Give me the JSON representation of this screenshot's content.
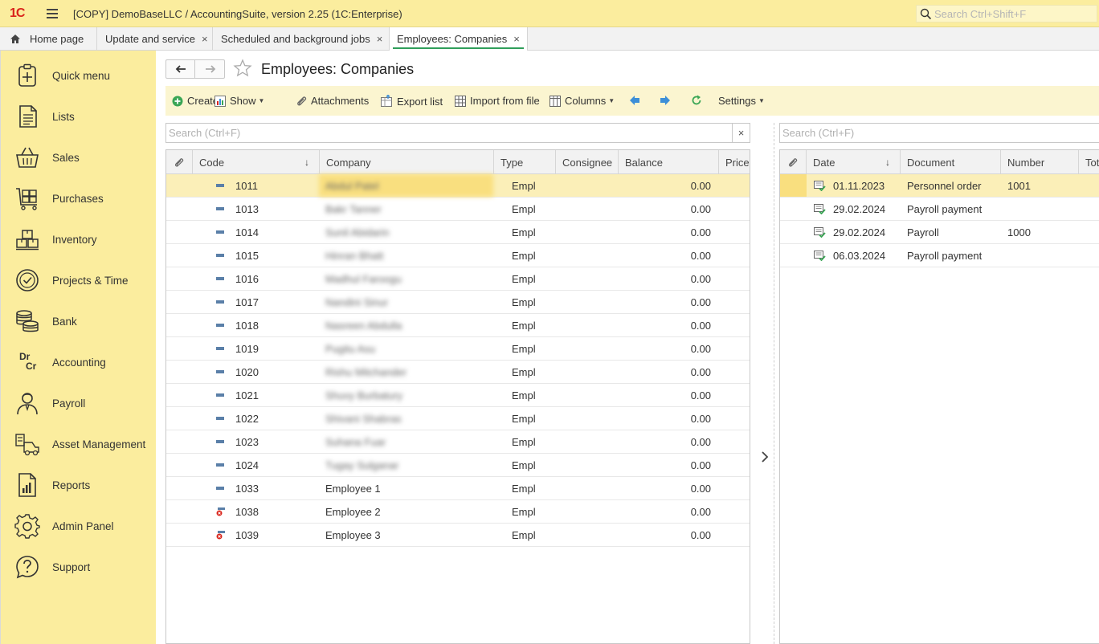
{
  "window": {
    "logo": "1C",
    "title": "[COPY] DemoBaseLLC / AccountingSuite, version 2.25  (1C:Enterprise)",
    "search_placeholder": "Search Ctrl+Shift+F"
  },
  "tabs": [
    {
      "label": "Home page",
      "icon": "home-icon"
    },
    {
      "label": "Update and service",
      "close": "×"
    },
    {
      "label": "Scheduled and background jobs",
      "close": "×"
    },
    {
      "label": "Employees: Companies",
      "close": "×",
      "active": true
    }
  ],
  "sidebar": {
    "items": [
      {
        "label": "Quick menu",
        "icon": "quick-menu-icon"
      },
      {
        "label": "Lists",
        "icon": "lists-icon"
      },
      {
        "label": "Sales",
        "icon": "basket-icon"
      },
      {
        "label": "Purchases",
        "icon": "cart-icon"
      },
      {
        "label": "Inventory",
        "icon": "boxes-icon"
      },
      {
        "label": "Projects & Time",
        "icon": "clock-icon"
      },
      {
        "label": "Bank",
        "icon": "coins-icon"
      },
      {
        "label": "Accounting",
        "icon": "dr-cr-icon",
        "glyph_top": "Dr",
        "glyph_bottom": "Cr"
      },
      {
        "label": "Payroll",
        "icon": "person-icon"
      },
      {
        "label": "Asset Management",
        "icon": "asset-icon"
      },
      {
        "label": "Reports",
        "icon": "report-icon"
      },
      {
        "label": "Admin Panel",
        "icon": "gear-icon"
      },
      {
        "label": "Support",
        "icon": "help-icon"
      }
    ]
  },
  "page": {
    "title": "Employees: Companies"
  },
  "toolbar": {
    "create": "Create",
    "show": "Show",
    "attachments": "Attachments",
    "export": "Export list",
    "import": "Import from file",
    "columns": "Columns",
    "settings": "Settings"
  },
  "left_search": {
    "placeholder": "Search (Ctrl+F)",
    "clear": "×"
  },
  "right_search": {
    "placeholder": "Search (Ctrl+F)"
  },
  "left_table": {
    "columns": [
      "Code",
      "Company",
      "Type",
      "Consignee",
      "Balance",
      "Price"
    ],
    "sort_arrow": "↓",
    "rows": [
      {
        "code": "1011",
        "company": "Abdul Patel",
        "type": "Empl",
        "balance": "0.00",
        "marked": false,
        "blurred": true
      },
      {
        "code": "1013",
        "company": "Bakr Tanner",
        "type": "Empl",
        "balance": "0.00",
        "marked": false,
        "blurred": true
      },
      {
        "code": "1014",
        "company": "Sunil Abidarin",
        "type": "Empl",
        "balance": "0.00",
        "marked": false,
        "blurred": true
      },
      {
        "code": "1015",
        "company": "Hinran Bhatt",
        "type": "Empl",
        "balance": "0.00",
        "marked": false,
        "blurred": true
      },
      {
        "code": "1016",
        "company": "Madhul Faroogu",
        "type": "Empl",
        "balance": "0.00",
        "marked": false,
        "blurred": true
      },
      {
        "code": "1017",
        "company": "Nandini Sinur",
        "type": "Empl",
        "balance": "0.00",
        "marked": false,
        "blurred": true
      },
      {
        "code": "1018",
        "company": "Nasreen Abdulla",
        "type": "Empl",
        "balance": "0.00",
        "marked": false,
        "blurred": true
      },
      {
        "code": "1019",
        "company": "Pugitu Asu",
        "type": "Empl",
        "balance": "0.00",
        "marked": false,
        "blurred": true
      },
      {
        "code": "1020",
        "company": "Rishu Mitchander",
        "type": "Empl",
        "balance": "0.00",
        "marked": false,
        "blurred": true
      },
      {
        "code": "1021",
        "company": "Shuvy Burbatury",
        "type": "Empl",
        "balance": "0.00",
        "marked": false,
        "blurred": true
      },
      {
        "code": "1022",
        "company": "Shivani Shabras",
        "type": "Empl",
        "balance": "0.00",
        "marked": false,
        "blurred": true
      },
      {
        "code": "1023",
        "company": "Suhana Fuar",
        "type": "Empl",
        "balance": "0.00",
        "marked": false,
        "blurred": true
      },
      {
        "code": "1024",
        "company": "Tugay Sulganar",
        "type": "Empl",
        "balance": "0.00",
        "marked": false,
        "blurred": true
      },
      {
        "code": "1033",
        "company": "Employee 1",
        "type": "Empl",
        "balance": "0.00",
        "marked": false,
        "blurred": false
      },
      {
        "code": "1038",
        "company": "Employee 2",
        "type": "Empl",
        "balance": "0.00",
        "marked": true,
        "blurred": false
      },
      {
        "code": "1039",
        "company": "Employee 3",
        "type": "Empl",
        "balance": "0.00",
        "marked": true,
        "blurred": false
      }
    ]
  },
  "right_table": {
    "columns": [
      "Date",
      "Document",
      "Number",
      "Tot"
    ],
    "sort_arrow": "↓",
    "rows": [
      {
        "date": "01.11.2023",
        "document": "Personnel order",
        "number": "1001"
      },
      {
        "date": "29.02.2024",
        "document": "Payroll payment",
        "number": ""
      },
      {
        "date": "29.02.2024",
        "document": "Payroll",
        "number": "1000"
      },
      {
        "date": "06.03.2024",
        "document": "Payroll payment",
        "number": ""
      }
    ]
  },
  "colors": {
    "accent_yellow": "#fbed9e",
    "selected_row": "#fbefb8",
    "active_tab_underline": "#2f9e5a",
    "create_icon": "#3aa655",
    "nav_arrow": "#3d8fd8",
    "refresh_icon": "#3aa655"
  }
}
